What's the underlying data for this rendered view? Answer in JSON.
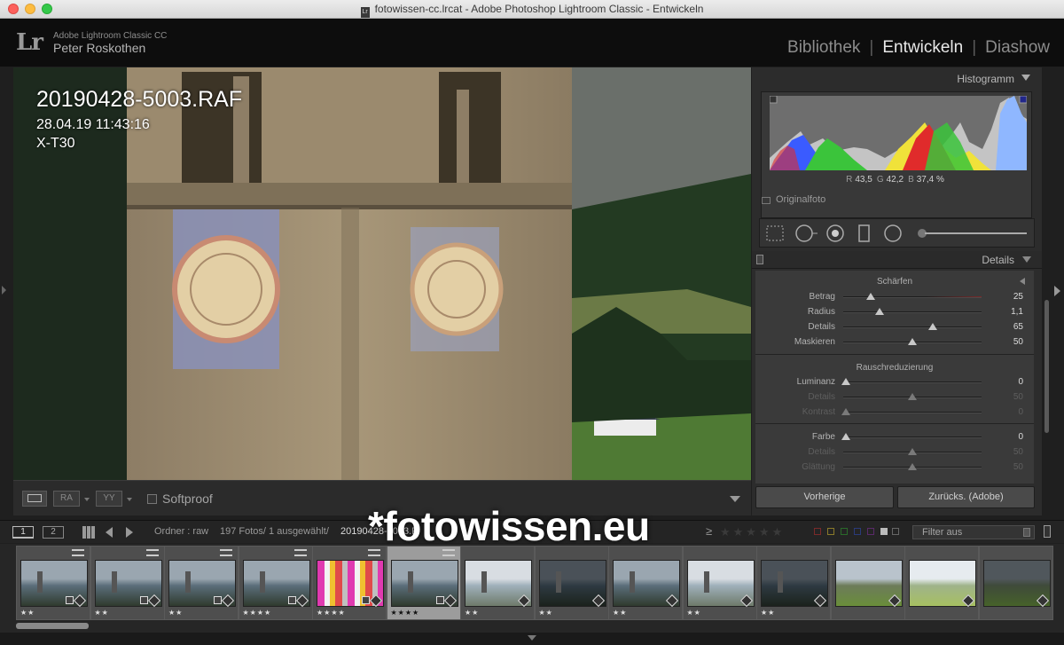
{
  "window": {
    "title": "fotowissen-cc.lrcat - Adobe Photoshop Lightroom Classic - Entwickeln",
    "doc_icon": "Lr"
  },
  "identity": {
    "logo": "Lr",
    "product": "Adobe Lightroom Classic CC",
    "user": "Peter Roskothen"
  },
  "modules": {
    "items": [
      "Bibliothek",
      "Entwickeln",
      "Diashow"
    ],
    "active": "Entwickeln"
  },
  "photo_info": {
    "filename": "20190428-5003.RAF",
    "datetime": "28.04.19 11:43:16",
    "camera": "X-T30"
  },
  "toolbar": {
    "softproof_label": "Softproof",
    "ra_label": "RA",
    "yy_label": "YY"
  },
  "histogram": {
    "title": "Histogramm",
    "r_label": "R",
    "r_value": "43,5",
    "g_label": "G",
    "g_value": "42,2",
    "b_label": "B",
    "b_value": "37,4 %",
    "original_label": "Originalfoto"
  },
  "details": {
    "title": "Details",
    "sharpening": {
      "title": "Schärfen",
      "rows": [
        {
          "label": "Betrag",
          "value": "25",
          "level": 0.2
        },
        {
          "label": "Radius",
          "value": "1,1",
          "level": 0.26
        },
        {
          "label": "Details",
          "value": "65",
          "level": 0.65
        },
        {
          "label": "Maskieren",
          "value": "50",
          "level": 0.5
        }
      ]
    },
    "noise": {
      "title": "Rauschreduzierung",
      "rows": [
        {
          "label": "Luminanz",
          "value": "0",
          "level": 0.02,
          "dim": false
        },
        {
          "label": "Details",
          "value": "50",
          "level": 0.5,
          "dim": true
        },
        {
          "label": "Kontrast",
          "value": "0",
          "level": 0.02,
          "dim": true
        },
        {
          "label": "Farbe",
          "value": "0",
          "level": 0.02,
          "dim": false
        },
        {
          "label": "Details",
          "value": "50",
          "level": 0.5,
          "dim": true
        },
        {
          "label": "Glättung",
          "value": "50",
          "level": 0.5,
          "dim": true
        }
      ]
    }
  },
  "buttons": {
    "previous": "Vorherige",
    "reset": "Zurücks. (Adobe)"
  },
  "filmbar": {
    "view1": "1",
    "view2": "2",
    "folder_label": "Ordner : raw",
    "count": "197 Fotos/ 1 ausgewählt/",
    "current_file": "20190428-5003.R",
    "filter_symbol": "≥",
    "filter_value": "Filter aus"
  },
  "watermark": "*fotowissen.eu",
  "filmstrip": [
    {
      "stars": "★★",
      "style": "lake"
    },
    {
      "stars": "★★",
      "style": "lake"
    },
    {
      "stars": "★★",
      "style": "lake"
    },
    {
      "stars": "★★★★",
      "style": "lake"
    },
    {
      "stars": "★★★★",
      "style": "pixel"
    },
    {
      "stars": "★★★★",
      "style": "lake",
      "selected": true
    },
    {
      "stars": "★★",
      "style": "lake-bright"
    },
    {
      "stars": "★★",
      "style": "lake-dark"
    },
    {
      "stars": "★★",
      "style": "lake"
    },
    {
      "stars": "★★",
      "style": "lake-bright"
    },
    {
      "stars": "★★",
      "style": "lake-dark"
    },
    {
      "stars": "",
      "style": "meadow"
    },
    {
      "stars": "",
      "style": "meadow-bright"
    },
    {
      "stars": "",
      "style": "meadow-dark"
    }
  ],
  "colors": {
    "accent_active": "#e8e8e8",
    "panel": "#2c2c2c",
    "histo_red": "#e02b2b",
    "histo_green": "#3bc43b",
    "histo_blue": "#3a5bff",
    "histo_yellow": "#f0e23a"
  }
}
